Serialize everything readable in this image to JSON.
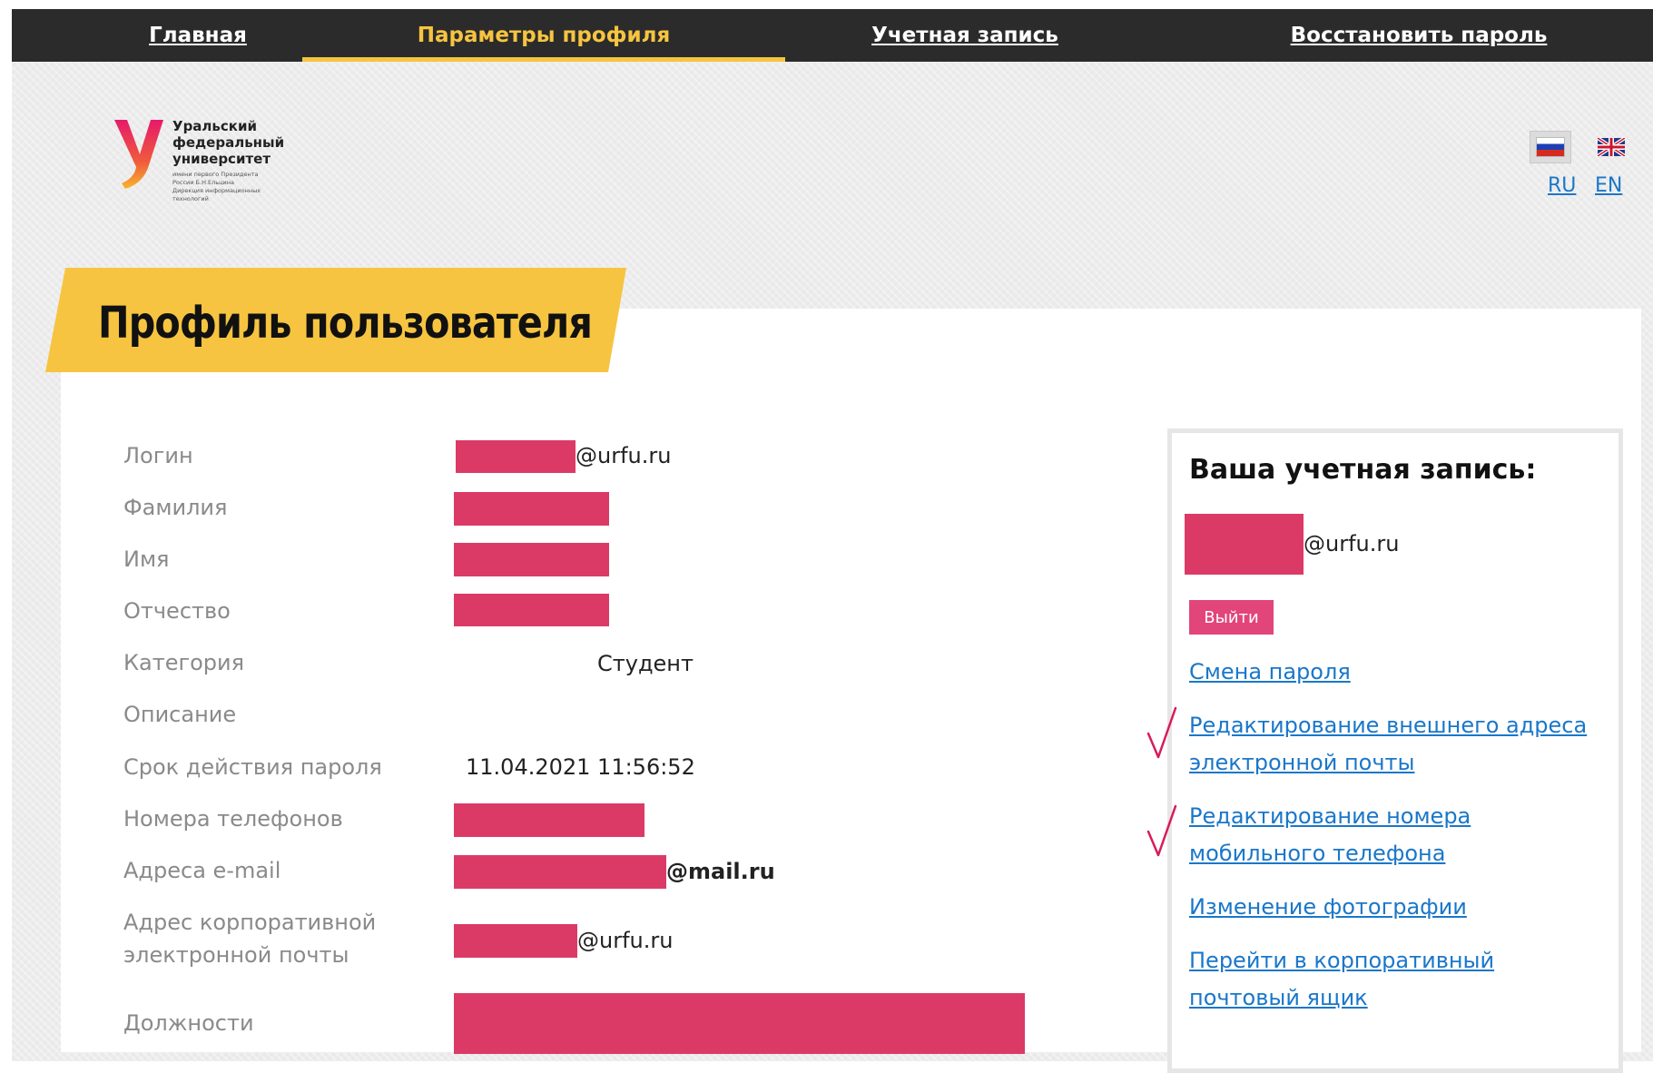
{
  "nav": {
    "items": [
      {
        "label": "Главная"
      },
      {
        "label": "Параметры профиля"
      },
      {
        "label": "Учетная запись"
      },
      {
        "label": "Восстановить пароль"
      }
    ]
  },
  "logo": {
    "title": "Уральский\nфедеральный\nуниверситет",
    "subtitle": "имени первого Президента\nРоссии Б.Н.Ельцина\nДирекция информационных\nтехнологий"
  },
  "lang": {
    "ru": "RU",
    "en": "EN"
  },
  "page_title": "Профиль пользователя",
  "profile": {
    "login_label": "Логин",
    "login_suffix": "@urfu.ru",
    "surname_label": "Фамилия",
    "name_label": "Имя",
    "patronymic_label": "Отчество",
    "category_label": "Категория",
    "category_value": "Студент",
    "description_label": "Описание",
    "password_expiry_label": "Срок действия пароля",
    "password_expiry_value": "11.04.2021 11:56:52",
    "phones_label": "Номера телефонов",
    "emails_label": "Адреса e-mail",
    "emails_suffix": "@mail.ru",
    "corp_email_label_1": "Адрес корпоративной",
    "corp_email_label_2": "электронной почты",
    "corp_email_suffix": "@urfu.ru",
    "positions_label": "Должности"
  },
  "account_panel": {
    "heading": "Ваша учетная запись:",
    "account_suffix": "@urfu.ru",
    "logout": "Выйти",
    "links": {
      "change_password": "Смена пароля",
      "edit_external_email_1": "Редактирование внешнего адреса",
      "edit_external_email_2": "электронной почты",
      "edit_phone_1": "Редактирование номера",
      "edit_phone_2": "мобильного телефона",
      "change_photo": "Изменение фотографии",
      "corp_mailbox_1": "Перейти в корпоративный",
      "corp_mailbox_2": "почтовый ящик"
    }
  },
  "colors": {
    "nav_bg": "#2b2b2b",
    "accent_yellow": "#f6c440",
    "redaction": "#dc3a66",
    "logout_button": "#e2457a",
    "link": "#1a77c9",
    "checkmark": "#d81b5a"
  }
}
